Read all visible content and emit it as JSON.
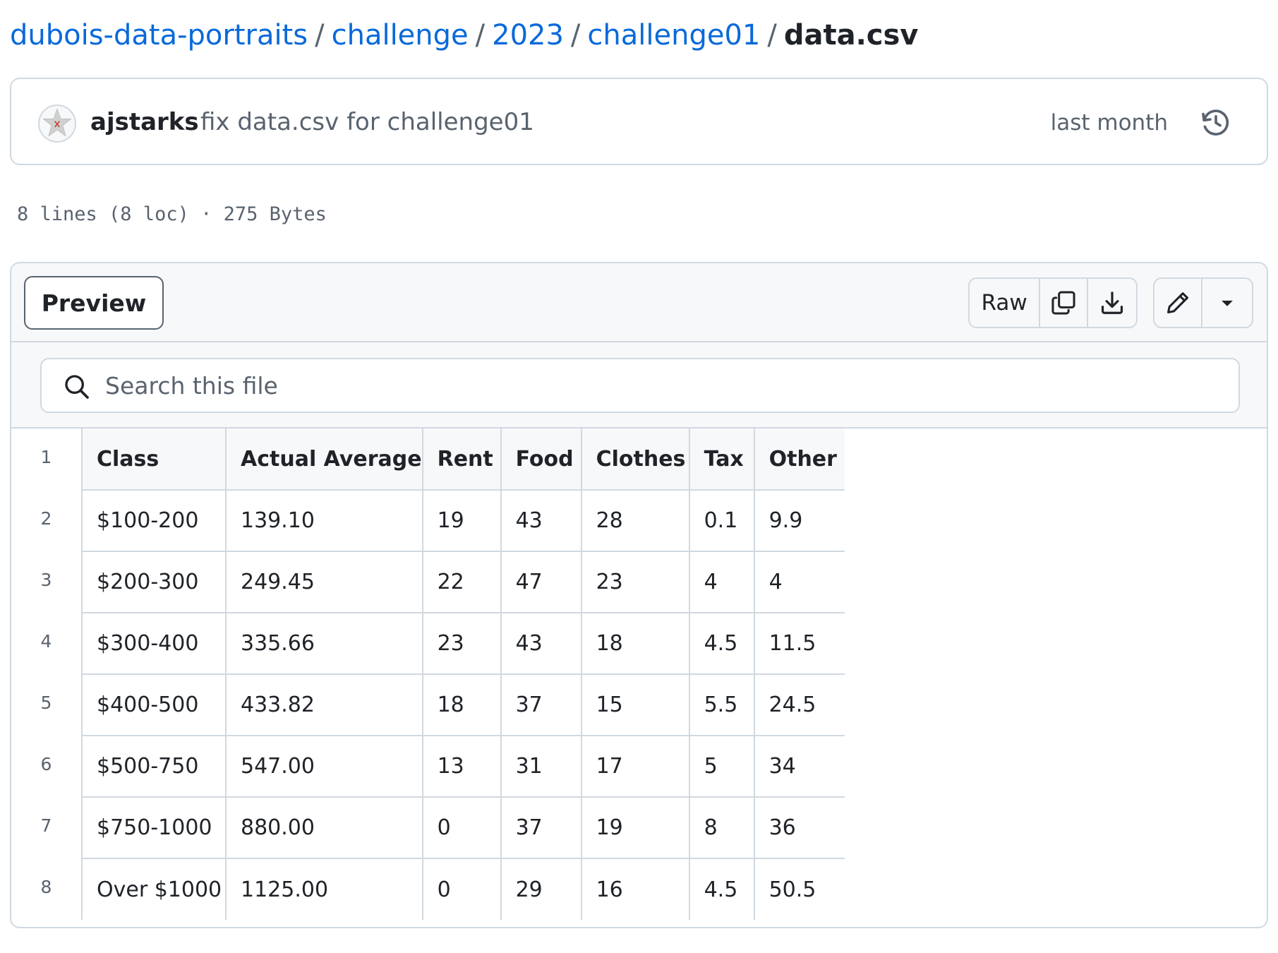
{
  "breadcrumb": {
    "parts": [
      "dubois-data-portraits",
      "challenge",
      "2023",
      "challenge01"
    ],
    "separator": "/",
    "current": "data.csv"
  },
  "commit": {
    "author": "ajstarks",
    "message": "fix data.csv for challenge01",
    "time": "last month"
  },
  "file_info": "8 lines (8 loc) · 275 Bytes",
  "toolbar": {
    "preview_label": "Preview",
    "raw_label": "Raw"
  },
  "search": {
    "placeholder": "Search this file"
  },
  "colors": {
    "link": "#0969da",
    "border": "#d1d9e0",
    "muted": "#59636e",
    "header_bg": "#f6f8fa"
  },
  "table": {
    "line_numbers": [
      "1",
      "2",
      "3",
      "4",
      "5",
      "6",
      "7",
      "8"
    ],
    "headers": [
      "Class",
      "Actual Average",
      "Rent",
      "Food",
      "Clothes",
      "Tax",
      "Other"
    ],
    "rows": [
      [
        "$100-200",
        "139.10",
        "19",
        "43",
        "28",
        "0.1",
        "9.9"
      ],
      [
        "$200-300",
        "249.45",
        "22",
        "47",
        "23",
        "4",
        "4"
      ],
      [
        "$300-400",
        "335.66",
        "23",
        "43",
        "18",
        "4.5",
        "11.5"
      ],
      [
        "$400-500",
        "433.82",
        "18",
        "37",
        "15",
        "5.5",
        "24.5"
      ],
      [
        "$500-750",
        "547.00",
        "13",
        "31",
        "17",
        "5",
        "34"
      ],
      [
        "$750-1000",
        "880.00",
        "0",
        "37",
        "19",
        "8",
        "36"
      ],
      [
        "Over $1000",
        "1125.00",
        "0",
        "29",
        "16",
        "4.5",
        "50.5"
      ]
    ]
  }
}
